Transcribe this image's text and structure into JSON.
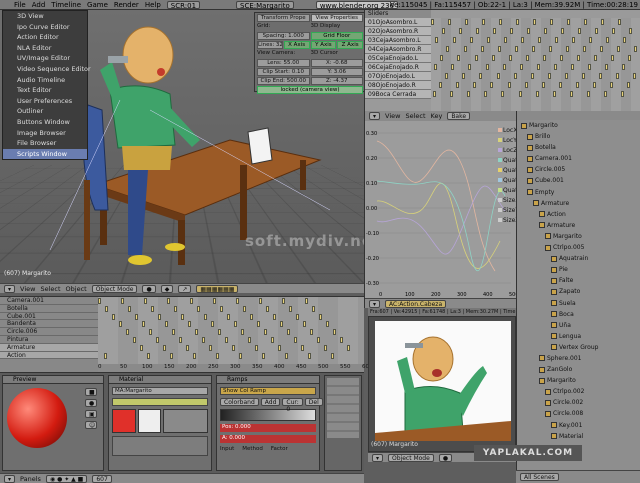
{
  "topbar": {
    "menus": [
      "File",
      "Add",
      "Timeline",
      "Game",
      "Render",
      "Help"
    ],
    "screen": "SCR:01",
    "scene": "SCE:Margarito",
    "site": "www.blender.org 236",
    "stats": "Ve:115045 | Fa:115457 | Ob:22-1 | La:3 | Mem:39.92M | Time:00:28:19"
  },
  "view3d_menu": [
    "3D View",
    "Ipo Curve Editor",
    "Action Editor",
    "NLA Editor",
    "UV/Image Editor",
    "Video Sequence Editor",
    "Audio Timeline",
    "Text Editor",
    "User Preferences",
    "Outliner",
    "Buttons Window",
    "Image Browser",
    "File Browser",
    "Scripts Window"
  ],
  "transform_panel": {
    "tab1": "Transform Prope",
    "tab2": "View Properties",
    "grid_label": "Grid:",
    "grid_btn": "3D Display",
    "grid_floor": "Grid Floor",
    "spacing": "Spacing: 1.000",
    "lines": "Lines: 32",
    "axes": [
      "X Axis",
      "Y Axis",
      "Z Axis"
    ],
    "view_camera": "View Camera:",
    "cursor": "3D Cursor",
    "lens": "Lens: 55.00",
    "clip_start": "Clip Start: 0.10",
    "clip_end": "Clip End: 500.00",
    "cx": "X: -0.68",
    "cy": "Y: 3.06",
    "cz": "Z: -4.37",
    "locked": "locked (camera view)"
  },
  "view3d_footer": {
    "label": "(607) Margarito",
    "items": [
      "View",
      "Select",
      "Object"
    ],
    "mode": "Object Mode"
  },
  "watermark": "soft.mydiv.net",
  "action_editor": {
    "header": "Sliders",
    "rows": [
      "01OjoAsombro.L",
      "02OjoAsombro.R",
      "03CejaAsombro.L",
      "04CejaAsombro.R",
      "05CejaEnojado.L",
      "06CejaEnojado.R",
      "07OjoEnojado.L",
      "08OjoEnojado.R",
      "09Boca Cerrada"
    ]
  },
  "ipo": {
    "menus": [
      "View",
      "Select",
      "Key"
    ],
    "bake": "Bake",
    "channels": [
      "LocX",
      "LocY",
      "LocZ",
      "QuatW",
      "QuatX",
      "QuatY",
      "QuatZ",
      "SizeX",
      "SizeY",
      "SizeZ"
    ],
    "yticks": [
      "0.30",
      "0.20",
      "0.10",
      "0.00",
      "-0.10",
      "-0.20",
      "-0.30"
    ],
    "xticks": [
      "0",
      "100",
      "200",
      "300",
      "400",
      "500"
    ],
    "action": "AC:Action.Cabeza"
  },
  "outliner": {
    "items": [
      "Margarito",
      "Brillo",
      "Botella",
      "Camera.001",
      "Circle.005",
      "Cube.001",
      "Empty",
      "Armature",
      "Action",
      "Armature",
      "Margarito",
      "Ctrlpo.005",
      "Aquatrain",
      "Pie",
      "Falte",
      "Zapato",
      "Suela",
      "Boca",
      "Uña",
      "Lengua",
      "Vertex Group",
      "Sphere.001",
      "ZanGolo",
      "Margarito",
      "Ctrlpo.002",
      "Circle.002",
      "Circle.008",
      "Key.001",
      "Material"
    ],
    "scenes": "All Scenes"
  },
  "timeline": {
    "names": [
      "Camera.001",
      "Botella",
      "Cube.001",
      "Bandenta",
      "Circle.006",
      "Pintura",
      "Armature",
      "Action"
    ],
    "ticks": [
      "0",
      "50",
      "100",
      "150",
      "200",
      "250",
      "300",
      "350",
      "400",
      "450",
      "500",
      "550",
      "600"
    ]
  },
  "buttons": {
    "preview": "Preview",
    "material": "Material",
    "ramps": "Ramps",
    "panels": "Panels",
    "frame": "607",
    "mat_name": "MA:Margarito",
    "ramp_btn": "Show Col Ramp",
    "colorband": "Colorband",
    "add": "Add",
    "del": "Del",
    "cur": "Cur: 0",
    "pos": "Pos: 0.000",
    "a": "A: 0.000",
    "input": "Input",
    "method": "Method",
    "factor": "Factor"
  },
  "render": {
    "stats": "Fra:607 | Ve:42915 | Fa:61748 | La:3 | Mem:30.27M | Time:00:20.36",
    "label": "(607) Margarito",
    "mode": "Object Mode"
  },
  "brand": "YAPLAKAL.COM"
}
